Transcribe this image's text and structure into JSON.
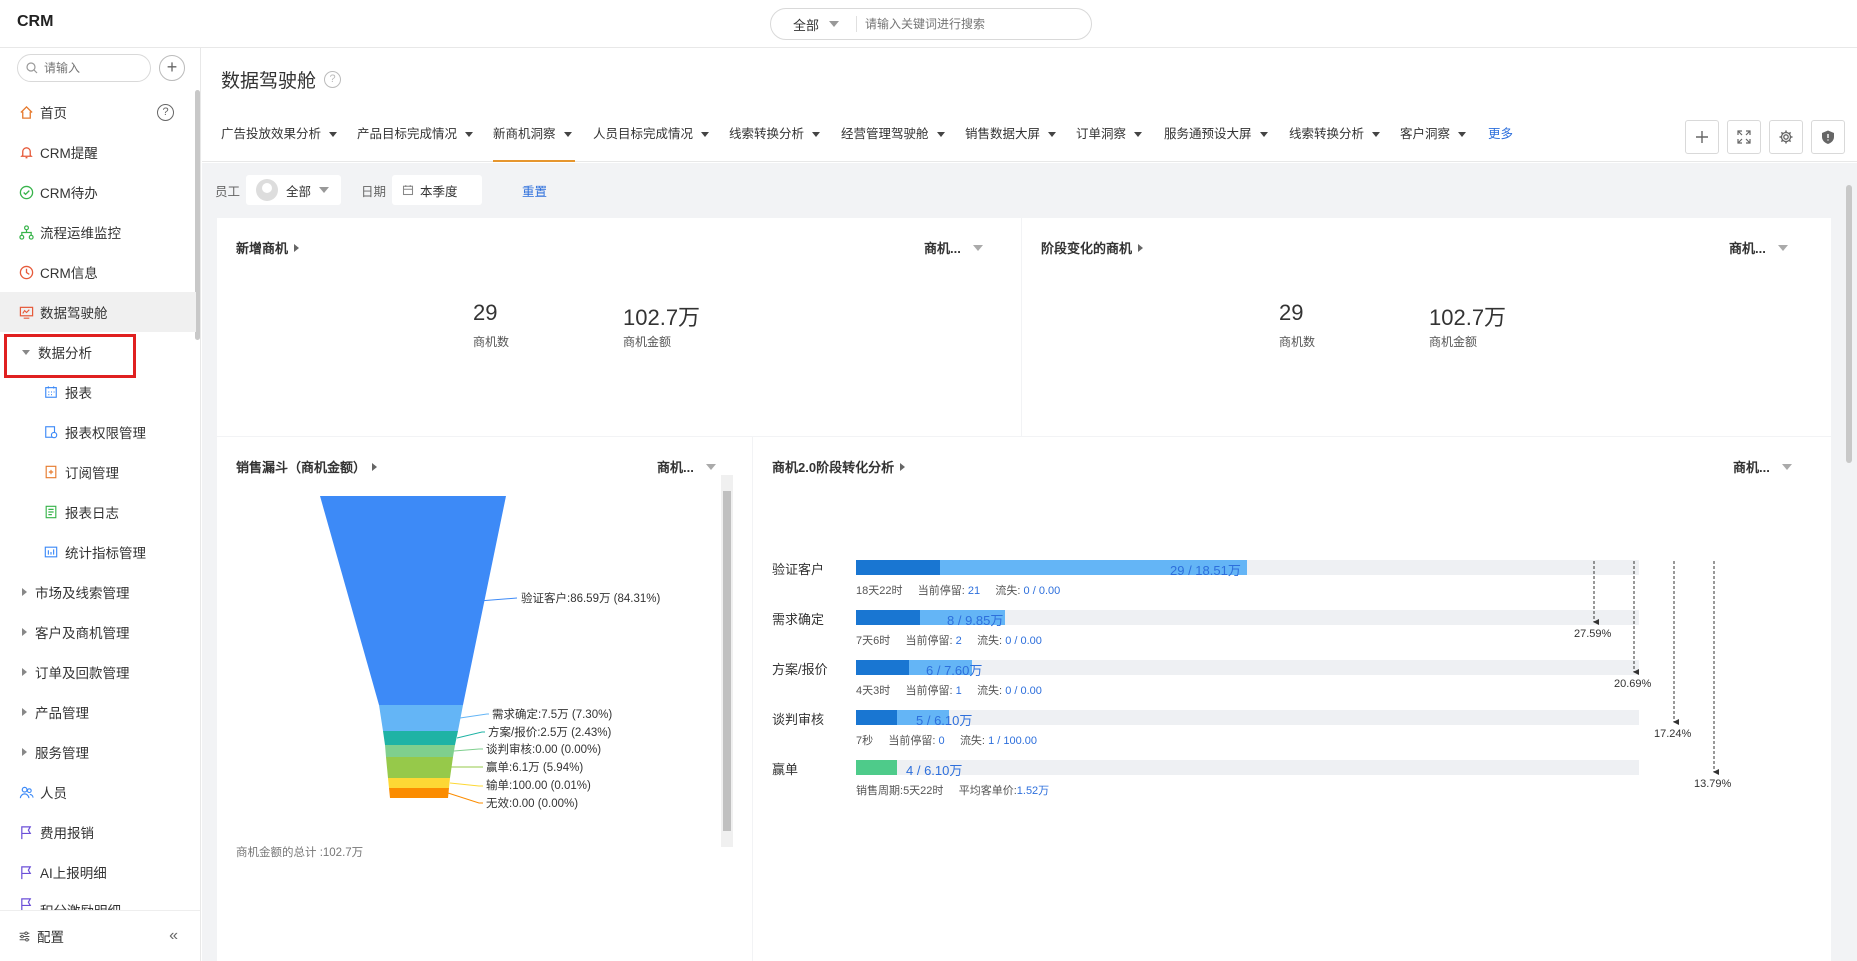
{
  "app": {
    "title": "CRM"
  },
  "global_search": {
    "scope": "全部",
    "placeholder": "请输入关键词进行搜索"
  },
  "sidebar": {
    "search_placeholder": "请输入",
    "items": [
      {
        "label": "首页"
      },
      {
        "label": "CRM提醒"
      },
      {
        "label": "CRM待办"
      },
      {
        "label": "流程运维监控"
      },
      {
        "label": "CRM信息"
      },
      {
        "label": "数据驾驶舱"
      },
      {
        "label": "数据分析"
      },
      {
        "label": "报表"
      },
      {
        "label": "报表权限管理"
      },
      {
        "label": "订阅管理"
      },
      {
        "label": "报表日志"
      },
      {
        "label": "统计指标管理"
      },
      {
        "label": "市场及线索管理"
      },
      {
        "label": "客户及商机管理"
      },
      {
        "label": "订单及回款管理"
      },
      {
        "label": "产品管理"
      },
      {
        "label": "服务管理"
      },
      {
        "label": "人员"
      },
      {
        "label": "费用报销"
      },
      {
        "label": "AI上报明细"
      },
      {
        "label": "积分激励明细"
      }
    ],
    "footer": {
      "label": "配置"
    }
  },
  "page": {
    "title": "数据驾驶舱"
  },
  "tabs": [
    {
      "label": "广告投放效果分析"
    },
    {
      "label": "产品目标完成情况"
    },
    {
      "label": "新商机洞察"
    },
    {
      "label": "人员目标完成情况"
    },
    {
      "label": "线索转换分析"
    },
    {
      "label": "经营管理驾驶舱"
    },
    {
      "label": "销售数据大屏"
    },
    {
      "label": "订单洞察"
    },
    {
      "label": "服务通预设大屏"
    },
    {
      "label": "线索转换分析"
    },
    {
      "label": "客户洞察"
    }
  ],
  "tabs_more": "更多",
  "filters": {
    "employee_label": "员工",
    "employee_value": "全部",
    "date_label": "日期",
    "date_value": "本季度",
    "reset": "重置"
  },
  "cards": {
    "new_opps": {
      "title": "新增商机",
      "selector": "商机...",
      "count": "29",
      "count_label": "商机数",
      "amount": "102.7万",
      "amount_label": "商机金额"
    },
    "stage_changed": {
      "title": "阶段变化的商机",
      "selector": "商机...",
      "count": "29",
      "count_label": "商机数",
      "amount": "102.7万",
      "amount_label": "商机金额"
    },
    "funnel": {
      "title": "销售漏斗（商机金额）",
      "selector": "商机...",
      "total": "商机金额的总计 :102.7万",
      "stages": [
        {
          "label": "验证客户:86.59万 (84.31%)",
          "color": "#3d8af7"
        },
        {
          "label": "需求确定:7.5万 (7.30%)",
          "color": "#64b5f6"
        },
        {
          "label": "方案/报价:2.5万 (2.43%)",
          "color": "#1fb3a5"
        },
        {
          "label": "谈判审核:0.00 (0.00%)",
          "color": "#7fcf8e"
        },
        {
          "label": "赢单:6.1万 (5.94%)",
          "color": "#96c94a"
        },
        {
          "label": "输单:100.00 (0.01%)",
          "color": "#fdd835"
        },
        {
          "label": "无效:0.00 (0.00%)",
          "color": "#fb8c00"
        }
      ]
    },
    "stage_analysis": {
      "title": "商机2.0阶段转化分析",
      "selector": "商机...",
      "stages": [
        {
          "name": "验证客户",
          "value": "29 / 18.51万",
          "dark": 0.107,
          "light": 0.392,
          "duration": "18天22时",
          "stay_label": "当前停留:",
          "stay": "21",
          "loss_label": "流失:",
          "loss": "0 / 0.00"
        },
        {
          "name": "需求确定",
          "value": "8 / 9.85万",
          "dark": 0.082,
          "light": 0.108,
          "duration": "7天6时",
          "stay_label": "当前停留:",
          "stay": "2",
          "loss_label": "流失:",
          "loss": "0 / 0.00"
        },
        {
          "name": "方案/报价",
          "value": "6 / 7.60万",
          "dark": 0.068,
          "light": 0.08,
          "duration": "4天3时",
          "stay_label": "当前停留:",
          "stay": "1",
          "loss_label": "流失:",
          "loss": "0 / 0.00"
        },
        {
          "name": "谈判审核",
          "value": "5 / 6.10万",
          "dark": 0.053,
          "light": 0.066,
          "duration": "7秒",
          "stay_label": "当前停留:",
          "stay": "0",
          "loss_label": "流失:",
          "loss": "1 / 100.00"
        },
        {
          "name": "赢单",
          "value": "4 / 6.10万",
          "dark": 0.053,
          "light": 0,
          "cycle_label": "销售周期:",
          "cycle": "5天22时",
          "avg_label": "平均客单价:",
          "avg": "1.52万"
        }
      ],
      "conversions": [
        "27.59%",
        "20.69%",
        "17.24%",
        "13.79%"
      ],
      "colors": {
        "dark": "#1976d2",
        "light": "#64b5f6",
        "won": "#4ecb8a",
        "track": "#eef0f3"
      }
    }
  }
}
